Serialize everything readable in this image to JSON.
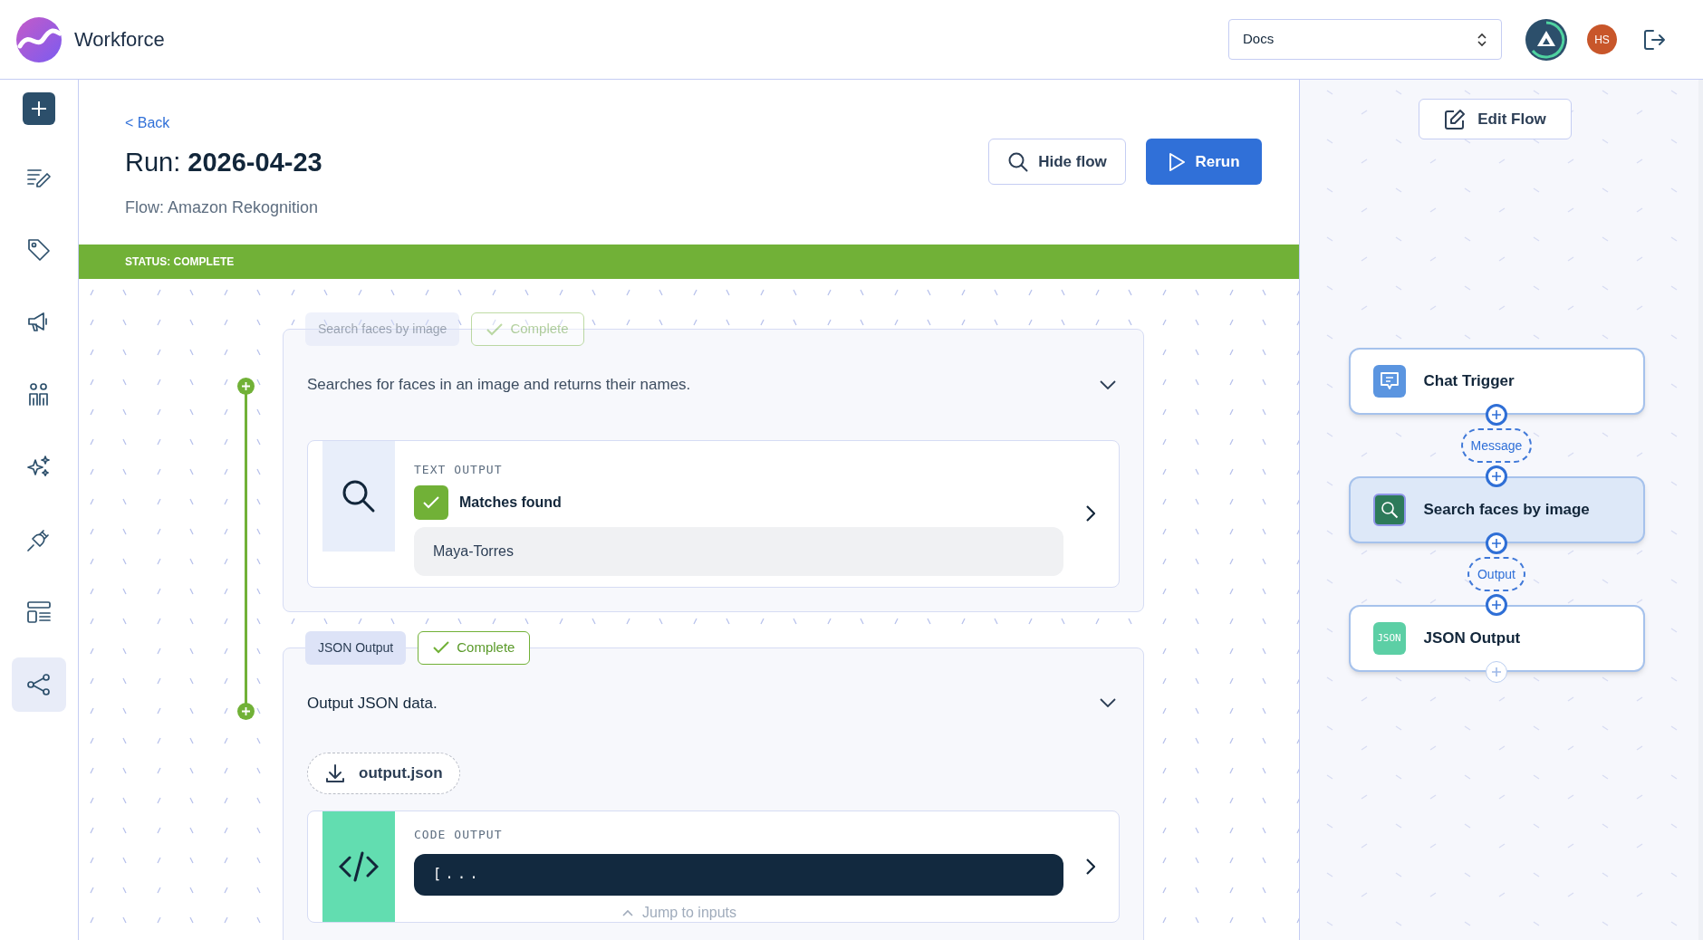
{
  "header": {
    "brand": "Workforce",
    "workspace_select": {
      "value": "Docs"
    },
    "user_initials": "HS"
  },
  "sidebar": {
    "items": [
      {
        "kind": "add",
        "selected": false
      },
      {
        "kind": "notes",
        "selected": false
      },
      {
        "kind": "tag",
        "selected": false
      },
      {
        "kind": "megaphone",
        "selected": false
      },
      {
        "kind": "people",
        "selected": false
      },
      {
        "kind": "sparkles",
        "selected": false
      },
      {
        "kind": "plug",
        "selected": false
      },
      {
        "kind": "layout",
        "selected": false
      },
      {
        "kind": "flow",
        "selected": true
      }
    ]
  },
  "run": {
    "back": "< Back",
    "title_prefix": "Run: ",
    "title": "2026-04-23",
    "flow": "Flow: Amazon Rekognition",
    "buttons": [
      {
        "kind": "hide",
        "label": "Hide flow"
      },
      {
        "kind": "rerun",
        "label": "Rerun"
      }
    ],
    "status": "STATUS: COMPLETE"
  },
  "steps": [
    {
      "title": "Search faces by image",
      "status": "Complete",
      "dimmed": true,
      "description": "Searches for faces in an image and returns their names.",
      "output": {
        "kind": "text",
        "label": "TEXT OUTPUT",
        "checked": true,
        "check_label": "Matches found",
        "value": "Maya-Torres"
      }
    },
    {
      "title": "JSON Output",
      "status": "Complete",
      "dimmed": false,
      "description": "Output JSON data.",
      "download": "output.json",
      "output": {
        "kind": "code",
        "label": "CODE OUTPUT",
        "value": "[..."
      }
    }
  ],
  "jump_link": "Jump to inputs",
  "flow_panel": {
    "edit_button": "Edit Flow",
    "nodes": [
      {
        "title": "Chat Trigger",
        "kind": "chat",
        "selected": false,
        "output_label": "Message"
      },
      {
        "title": "Search faces by image",
        "kind": "search",
        "selected": true,
        "output_label": "Output"
      },
      {
        "title": "JSON Output",
        "kind": "json",
        "selected": false,
        "icon_text": "JSON"
      }
    ]
  }
}
